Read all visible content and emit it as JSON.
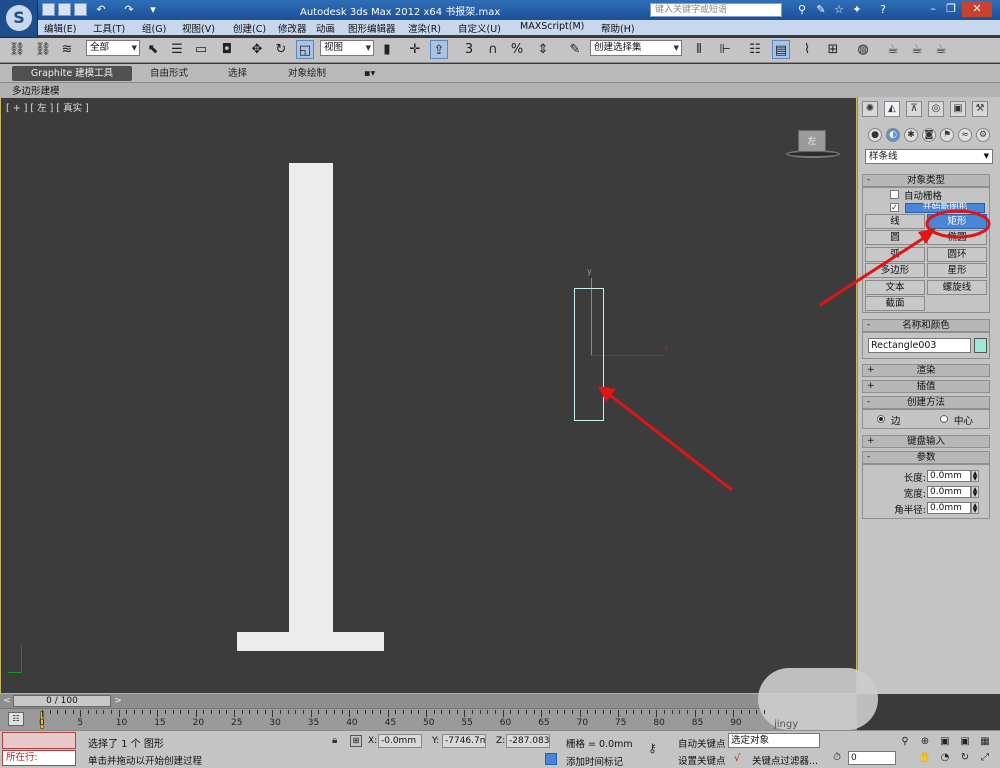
{
  "titlebar": {
    "title": "Autodesk 3ds Max  2012 x64      书报架.max",
    "search_placeholder": "键入关键字或短语",
    "quick_access_icons": [
      "new-file-icon",
      "open-file-icon",
      "save-icon",
      "undo-icon",
      "redo-icon",
      "dropdown-icon"
    ],
    "right_icons": [
      "binoculars-icon",
      "tools-icon",
      "star-icon",
      "help-icon"
    ]
  },
  "menu": [
    "编辑(E)",
    "工具(T)",
    "组(G)",
    "视图(V)",
    "创建(C)",
    "修改器",
    "动画",
    "图形编辑器",
    "渲染(R)",
    "自定义(U)",
    "MAXScript(M)",
    "帮助(H)"
  ],
  "toolbar": {
    "selection_filter": "全部",
    "reference_coord": "视图",
    "named_selection": "创建选择集",
    "snap_label": "3",
    "snap_angle_label": "%"
  },
  "ribbon": {
    "tabs": [
      "Graphite 建模工具",
      "自由形式",
      "选择",
      "对象绘制"
    ],
    "sub_label": "多边形建模"
  },
  "viewport": {
    "label": "[ + ] [ 左 ] [ 真实 ]",
    "viewcube_label": "左",
    "axis_x": "x",
    "axis_y": "y"
  },
  "command_panel": {
    "category": "样条线",
    "object_type_title": "对象类型",
    "auto_grid": "自动栅格",
    "start_new_shape": "开始新图形",
    "buttons": [
      [
        "线",
        "矩形"
      ],
      [
        "圆",
        "椭圆"
      ],
      [
        "弧",
        "圆环"
      ],
      [
        "多边形",
        "星形"
      ],
      [
        "文本",
        "螺旋线"
      ],
      [
        "截面",
        ""
      ]
    ],
    "active_button": "矩形",
    "name_color_title": "名称和颜色",
    "object_name": "Rectangle003",
    "object_color": "#9fe7d6",
    "rollouts": {
      "rendering": "渲染",
      "interpolation": "插值",
      "creation_method": "创建方法",
      "keyboard_entry": "键盘输入",
      "parameters": "参数"
    },
    "creation_options": [
      "边",
      "中心"
    ],
    "params": [
      {
        "label": "长度:",
        "value": "0.0mm"
      },
      {
        "label": "宽度:",
        "value": "0.0mm"
      },
      {
        "label": "角半径:",
        "value": "0.0mm"
      }
    ]
  },
  "timeline": {
    "slider": "0 / 100",
    "ticks": [
      "0",
      "5",
      "10",
      "15",
      "20",
      "25",
      "30",
      "35",
      "40",
      "45",
      "50",
      "55",
      "60",
      "65",
      "70",
      "75",
      "80",
      "85",
      "90"
    ]
  },
  "status": {
    "running": "所在行:",
    "selected": "选择了 1 个 图形",
    "prompt": "单击并拖动以开始创建过程",
    "x_label": "X:",
    "x_value": "-0.0mm",
    "y_label": "Y:",
    "y_value": "-7746.7m",
    "z_label": "Z:",
    "z_value": "-287.083m",
    "grid": "栅格 = 0.0mm",
    "add_time_tag": "添加时间标记",
    "auto_key": "自动关键点",
    "set_key": "设置关键点",
    "selected_combo": "选定对象",
    "key_filters": "关键点过滤器...",
    "frame": "0"
  },
  "watermark": "jingy"
}
